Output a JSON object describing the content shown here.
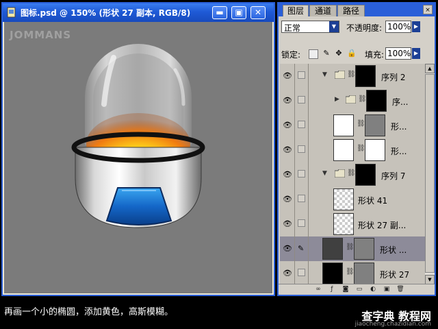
{
  "document": {
    "title": "图标.psd @ 150% (形状 27 副本, RGB/8)",
    "watermark": "JOMMANS",
    "buttons": {
      "minimize": "▬",
      "restore": "▣",
      "close": "✕"
    }
  },
  "layers_panel": {
    "tabs": [
      "图层",
      "通道",
      "路径"
    ],
    "close": "×",
    "blend_mode": "正常",
    "opacity_label": "不透明度:",
    "opacity_value": "100%",
    "lock_label": "锁定:",
    "fill_label": "填充:",
    "fill_value": "100%",
    "layers": [
      {
        "name": "序列 2"
      },
      {
        "name": "序..."
      },
      {
        "name": "形..."
      },
      {
        "name": "形..."
      },
      {
        "name": "序列 7"
      },
      {
        "name": "形状 41"
      },
      {
        "name": "形状 27 副..."
      },
      {
        "name": "形状 ..."
      },
      {
        "name": "形状 27"
      }
    ]
  },
  "caption": "再画一个小的椭圆，添加黄色，高斯模糊。",
  "site": {
    "name": "查字典 教程网",
    "url": "jiaocheng.chazidian.com"
  },
  "colors": {
    "titlebar": "#2a5fd8",
    "canvas_bg": "#7b7b7b",
    "panel_bg": "#d4d0c8",
    "selected_layer": "#8d8b99"
  }
}
